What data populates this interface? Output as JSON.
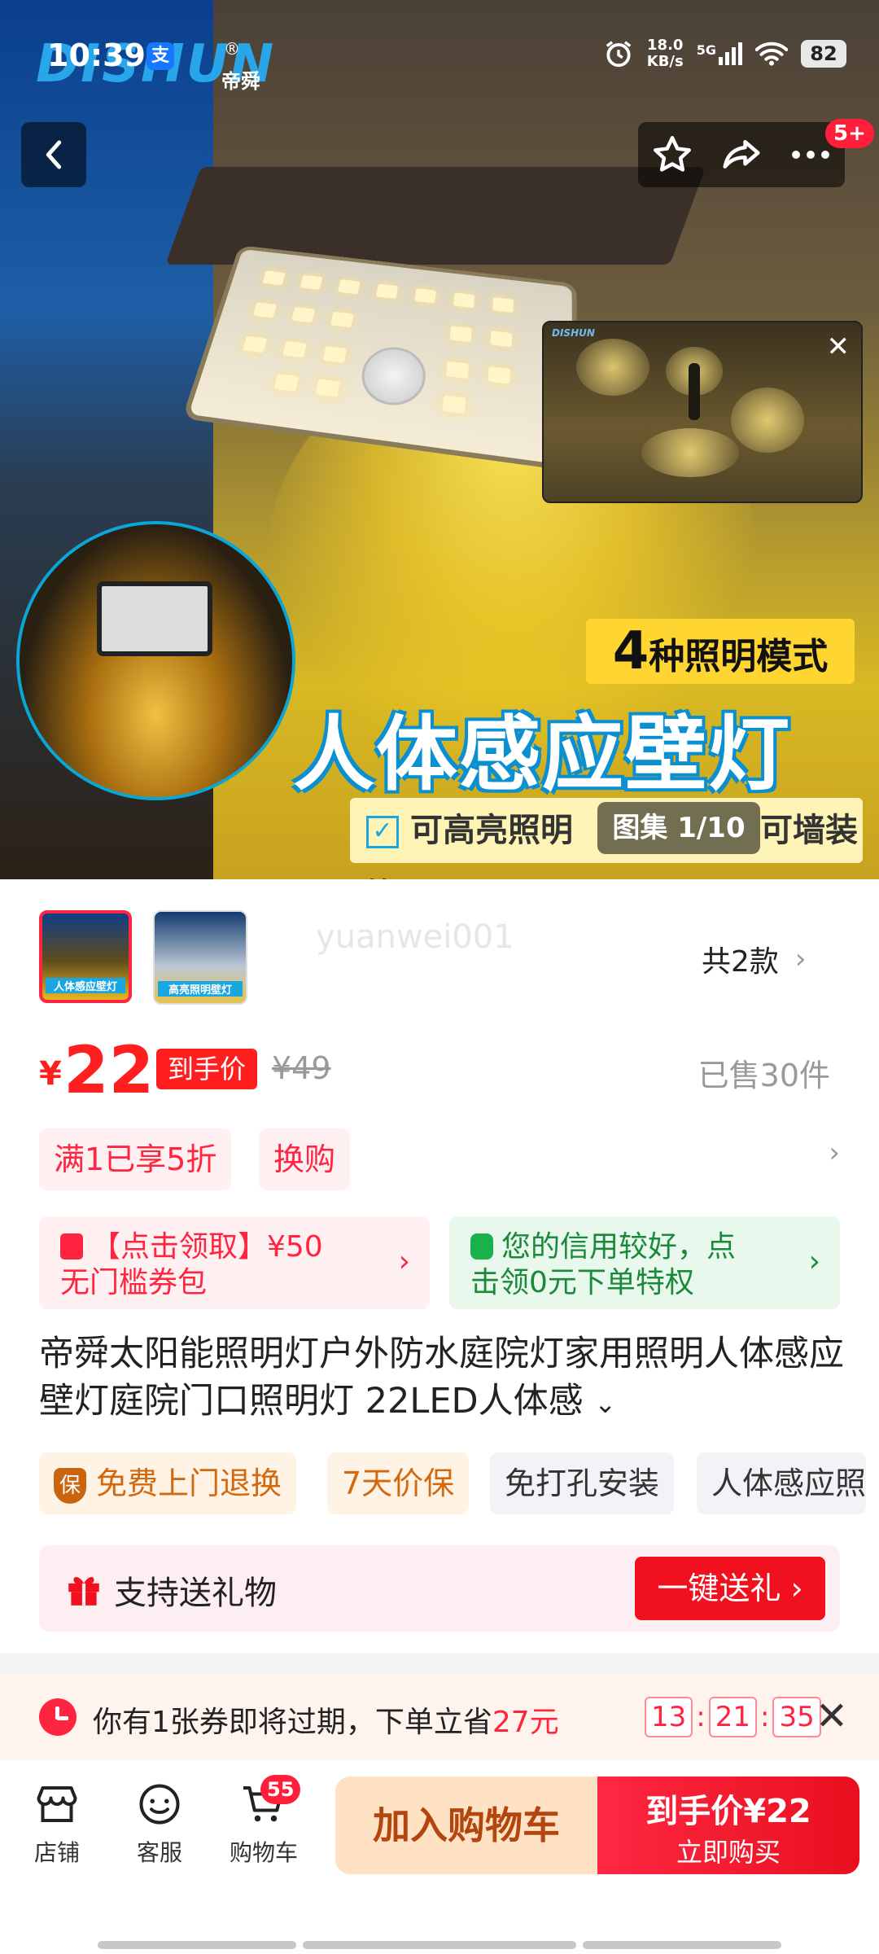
{
  "status_bar": {
    "time": "10:39",
    "alipay_glyph": "支",
    "net_speed_value": "18.0",
    "net_speed_unit": "KB/s",
    "network": "5G",
    "battery": "82"
  },
  "hero": {
    "brand_logo": "DISHUN",
    "brand_cn": "帝舜",
    "registered": "®",
    "mode_count": "4",
    "mode_text": "种照明模式",
    "slogan": "人体感应壁灯",
    "feature_text": "可高亮照明",
    "feature_text_tail": "可墙装饰",
    "gallery_counter": "图集 1/10",
    "notification_badge": "5+",
    "video_logo": "DISHUN"
  },
  "variants": {
    "thumb1_caption": "人体感应壁灯",
    "thumb2_caption": "高亮照明壁灯",
    "watermark": "yuanwei001",
    "count_label": "共2款"
  },
  "price": {
    "currency": "¥",
    "value": "22",
    "tag": "到手价",
    "original": "¥49",
    "sold": "已售30件"
  },
  "promotions": {
    "chip1": "满1已享5折",
    "chip2": "换购"
  },
  "coupons": {
    "red_line1": "【点击领取】¥50",
    "red_line2": "无门槛券包",
    "green_line1": "您的信用较好，点",
    "green_line2": "击领0元下单特权"
  },
  "product_title": "帝舜太阳能照明灯户外防水庭院灯家用照明人体感应壁灯庭院门口照明灯 22LED人体感",
  "services": {
    "tag1_icon": "保",
    "tag1": "免费上门退换",
    "tag2": "7天价保",
    "tag3": "免打孔安装",
    "tag4": "人体感应照明"
  },
  "gift": {
    "text": "支持送礼物",
    "button": "一键送礼 ›"
  },
  "expiring": {
    "prefix": "你有1张券即将过期，下单立省",
    "amount": "27元",
    "h": "13",
    "m": "21",
    "s": "35"
  },
  "bottom_bar": {
    "shop": "店铺",
    "service": "客服",
    "cart": "购物车",
    "cart_badge": "55",
    "add_to_cart": "加入购物车",
    "buy_line1": "到手价¥22",
    "buy_line2": "立即购买"
  }
}
